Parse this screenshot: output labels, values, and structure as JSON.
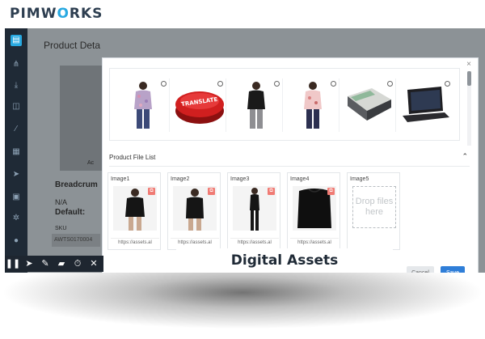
{
  "brand": {
    "logo_pre": "PIMW",
    "logo_o": "O",
    "logo_post": "RKS"
  },
  "background_page": {
    "title": "Product Deta",
    "breadcrumb_label": "Breadcrum",
    "na_text": "N/A",
    "default_label": "Default:",
    "sku_label": "SKU",
    "sku_value": "AWTS0170004",
    "small_button": "Ac"
  },
  "sidebar": {
    "icons": [
      "database-icon",
      "hierarchy-icon",
      "download-icon",
      "box-icon",
      "wand-icon",
      "grid-icon",
      "send-icon",
      "calendar-icon",
      "gear-icon",
      "user-icon"
    ]
  },
  "modal": {
    "close_label": "×",
    "gallery": [
      {
        "name": "floral-blouse-model"
      },
      {
        "name": "translate-button-graphic",
        "text": "TRANSLATE"
      },
      {
        "name": "black-top-model"
      },
      {
        "name": "pink-blouse-model"
      },
      {
        "name": "laptop-open"
      },
      {
        "name": "laptop-dark"
      }
    ],
    "section_title": "Product File List",
    "section_chevron": "⌃",
    "files": [
      {
        "label": "Image1",
        "url": "https://assets.al"
      },
      {
        "label": "Image2",
        "url": "https://assets.al"
      },
      {
        "label": "Image3",
        "url": "https://assets.al"
      },
      {
        "label": "Image4",
        "url": "https://assets.al"
      },
      {
        "label": "Image5",
        "drop_text": "Drop files here"
      }
    ],
    "cancel_label": "Cancel",
    "save_label": "Save"
  },
  "caption": "Digital Assets",
  "recorder_toolbar": {
    "buttons": [
      "pause-icon",
      "cursor-icon",
      "pen-icon",
      "eraser-icon",
      "timer-icon",
      "close-icon"
    ],
    "glyphs": [
      "❚❚",
      "➤",
      "✎",
      "▰",
      "⏱",
      "✕"
    ]
  },
  "colors": {
    "accent": "#28a9e1",
    "save": "#2f7ed8",
    "delete": "#f07b74",
    "sidebar": "#1f2a36"
  }
}
